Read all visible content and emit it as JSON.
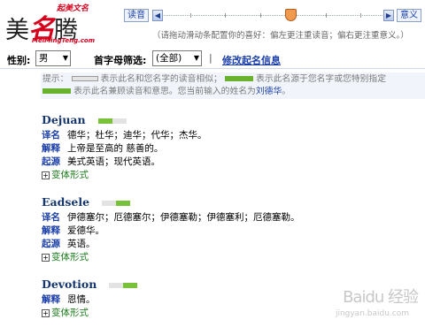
{
  "logo": {
    "main_left": "美",
    "main_mid": "名",
    "main_right": "腾",
    "tagline": "起美文名",
    "url": "MeiMingTeng.com"
  },
  "slider": {
    "left_label": "读音",
    "right_label": "意义",
    "hint": "（请拖动滑动条配置你的喜好：偏左更注重读音；偏右更注重意义。）",
    "position": 0.58
  },
  "filters": {
    "gender_label": "性别:",
    "gender_value": "男",
    "initial_label": "首字母筛选:",
    "initial_value": "(全部)",
    "separator": "|",
    "modify_link": "修改起名信息"
  },
  "legend": {
    "line1_a": "提示：",
    "line1_b": "表示此名和您名字的读音相似；",
    "line1_c": "表示此名源于您名字或您特别指定",
    "line2_a": "表示此名兼顾读音和意思。您当前输入的姓名为",
    "current_name": "刘德华",
    "line2_end": "。"
  },
  "entries": [
    {
      "name": "Dejuan",
      "meter_start": 0.0,
      "meter_fill": 0.5,
      "rows": [
        {
          "key": "译名",
          "value": "德华；杜华；迪华；代华；杰华。"
        },
        {
          "key": "解释",
          "value": "上帝是至高的 慈善的。"
        },
        {
          "key": "起源",
          "value": "美式英语；现代英语。"
        }
      ],
      "variant": "变体形式"
    },
    {
      "name": "Eadsele",
      "meter_start": 0.5,
      "meter_fill": 0.5,
      "rows": [
        {
          "key": "译名",
          "value": "伊德塞尔；厄德塞尔；伊德塞勒；伊德塞利；厄德塞勒。"
        },
        {
          "key": "解释",
          "value": "爱德华。"
        },
        {
          "key": "起源",
          "value": "英语。"
        }
      ],
      "variant": "变体形式"
    },
    {
      "name": "Devotion",
      "meter_start": 0.5,
      "meter_fill": 0.5,
      "rows": [
        {
          "key": "解释",
          "value": "恩情。"
        }
      ],
      "variant": "变体形式"
    }
  ],
  "watermark": {
    "text": "Baidu 经验",
    "url": "jingyan.baidu.com"
  },
  "colors": {
    "link_blue": "#1a3ea8",
    "green_meter": "#78c23a",
    "thumb_orange": "#f1994c",
    "logo_red": "#d4001c"
  }
}
